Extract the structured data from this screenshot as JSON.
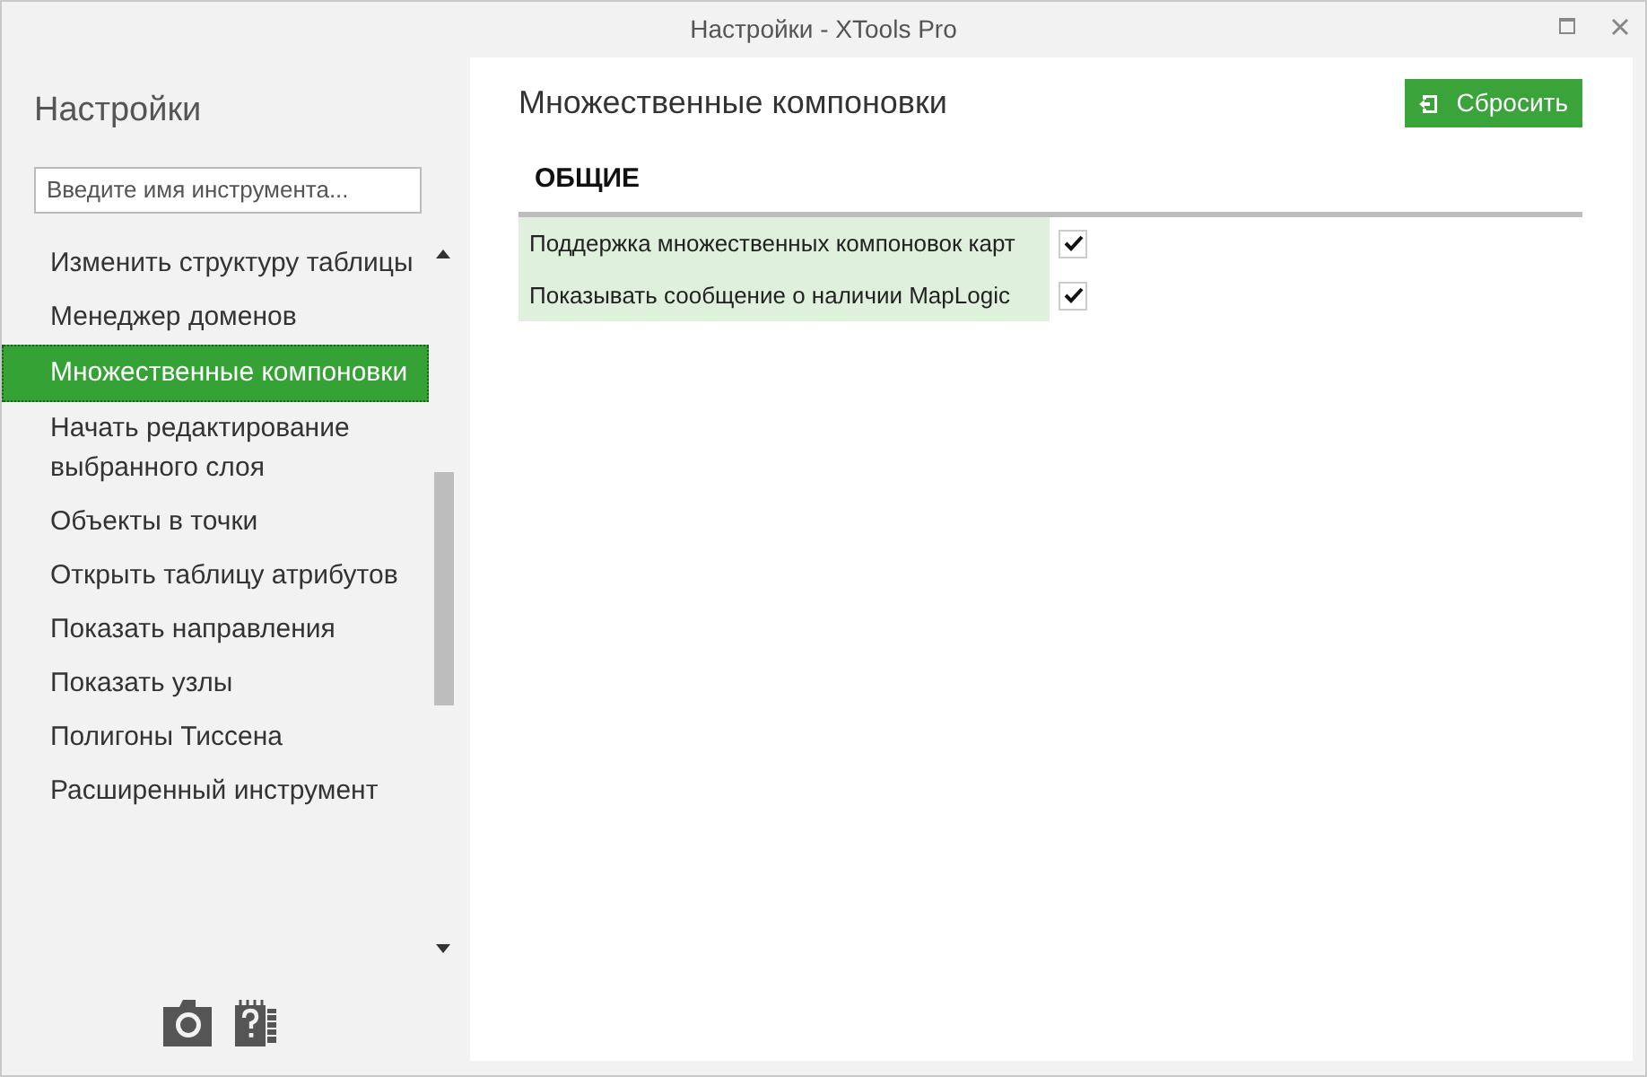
{
  "window": {
    "title": "Настройки - XTools Pro"
  },
  "sidebar": {
    "title": "Настройки",
    "search": {
      "placeholder": "Введите имя инструмента..."
    },
    "items": [
      {
        "label": "Изменить структуру таблицы",
        "selected": false
      },
      {
        "label": "Менеджер доменов",
        "selected": false
      },
      {
        "label": "Множественные компоновки",
        "selected": true
      },
      {
        "label": "Начать редактирование выбранного слоя",
        "selected": false
      },
      {
        "label": "Объекты в точки",
        "selected": false
      },
      {
        "label": "Открыть таблицу атрибутов",
        "selected": false
      },
      {
        "label": "Показать направления",
        "selected": false
      },
      {
        "label": "Показать узлы",
        "selected": false
      },
      {
        "label": "Полигоны Тиссена",
        "selected": false
      },
      {
        "label": "Расширенный инструмент",
        "selected": false
      }
    ]
  },
  "content": {
    "title": "Множественные компоновки",
    "reset_button": "Сбросить",
    "section": "ОБЩИЕ",
    "options": [
      {
        "label": "Поддержка множественных компоновок карт",
        "checked": true
      },
      {
        "label": "Показывать сообщение о наличии MapLogic",
        "checked": true
      }
    ]
  }
}
